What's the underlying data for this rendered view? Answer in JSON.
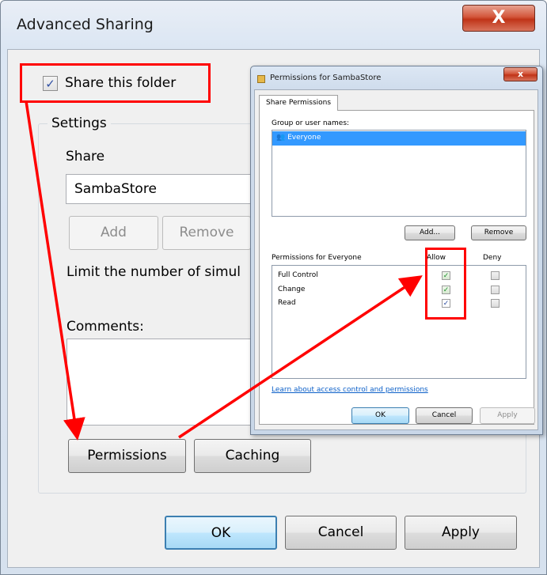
{
  "advanced_sharing": {
    "title": "Advanced Sharing",
    "close_glyph": "X",
    "share_checkbox": {
      "label": "Share this folder",
      "checked": true,
      "mark": "✓"
    },
    "settings": {
      "group_label": "Settings",
      "share_name_label": "Share",
      "share_name_value": "SambaStore",
      "add_label": "Add",
      "remove_label": "Remove",
      "limit_label": "Limit the number of simul",
      "comments_label": "Comments:",
      "comments_value": ""
    },
    "buttons": {
      "permissions": "Permissions",
      "caching": "Caching",
      "ok": "OK",
      "cancel": "Cancel",
      "apply": "Apply"
    }
  },
  "permissions_dialog": {
    "title": "Permissions for SambaStore",
    "close_glyph": "x",
    "tab": "Share Permissions",
    "group_label": "Group or user names:",
    "users": [
      "Everyone"
    ],
    "add_label": "Add...",
    "remove_label": "Remove",
    "permissions_for": "Permissions for Everyone",
    "allow_header": "Allow",
    "deny_header": "Deny",
    "rows": [
      {
        "name": "Full Control",
        "allow": true,
        "deny": false
      },
      {
        "name": "Change",
        "allow": true,
        "deny": false
      },
      {
        "name": "Read",
        "allow": true,
        "deny": false
      }
    ],
    "check_mark": "✓",
    "learn_link": "Learn about access control and permissions",
    "ok": "OK",
    "cancel": "Cancel",
    "apply": "Apply"
  },
  "colors": {
    "annotation": "#ff0000",
    "selection": "#3399ff",
    "link": "#0b5fc8"
  }
}
